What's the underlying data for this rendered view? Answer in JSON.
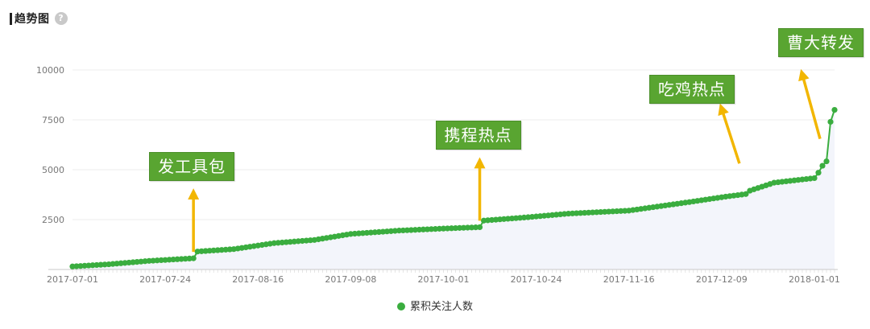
{
  "header": {
    "title": "趋势图",
    "help_icon": "?"
  },
  "chart_data": {
    "type": "area",
    "x_axis_labels": [
      "2017-07-01",
      "2017-07-24",
      "2017-08-16",
      "2017-09-08",
      "2017-10-01",
      "2017-10-24",
      "2017-11-16",
      "2017-12-09",
      "2018-01-01"
    ],
    "x_range": [
      "2017-07-01",
      "2018-01-06"
    ],
    "y_ticks": [
      2500,
      5000,
      7500,
      10000
    ],
    "ylim": [
      0,
      10000
    ],
    "series": [
      {
        "name": "累积关注人数",
        "color": "#3aad3f",
        "points": [
          [
            "2017-07-01",
            150
          ],
          [
            "2017-07-10",
            260
          ],
          [
            "2017-07-20",
            430
          ],
          [
            "2017-07-31",
            560
          ],
          [
            "2017-08-01",
            900
          ],
          [
            "2017-08-10",
            1020
          ],
          [
            "2017-08-20",
            1320
          ],
          [
            "2017-08-30",
            1480
          ],
          [
            "2017-09-08",
            1780
          ],
          [
            "2017-09-20",
            1950
          ],
          [
            "2017-10-01",
            2050
          ],
          [
            "2017-10-10",
            2120
          ],
          [
            "2017-10-11",
            2450
          ],
          [
            "2017-10-22",
            2620
          ],
          [
            "2017-11-01",
            2800
          ],
          [
            "2017-11-16",
            2950
          ],
          [
            "2017-12-01",
            3380
          ],
          [
            "2017-12-10",
            3650
          ],
          [
            "2017-12-15",
            3780
          ],
          [
            "2017-12-16",
            3950
          ],
          [
            "2017-12-22",
            4350
          ],
          [
            "2018-01-01",
            4580
          ],
          [
            "2018-01-02",
            4850
          ],
          [
            "2018-01-03",
            5200
          ],
          [
            "2018-01-04",
            5420
          ],
          [
            "2018-01-05",
            7400
          ],
          [
            "2018-01-06",
            8000
          ]
        ]
      }
    ],
    "annotations": [
      {
        "label": "发工具包",
        "date": "2017-07-31"
      },
      {
        "label": "携程热点",
        "date": "2017-10-10"
      },
      {
        "label": "吃鸡热点",
        "date": "2017-12-15"
      },
      {
        "label": "曹大转发",
        "date": "2018-01-04"
      }
    ],
    "legend_position": "bottom-center"
  }
}
